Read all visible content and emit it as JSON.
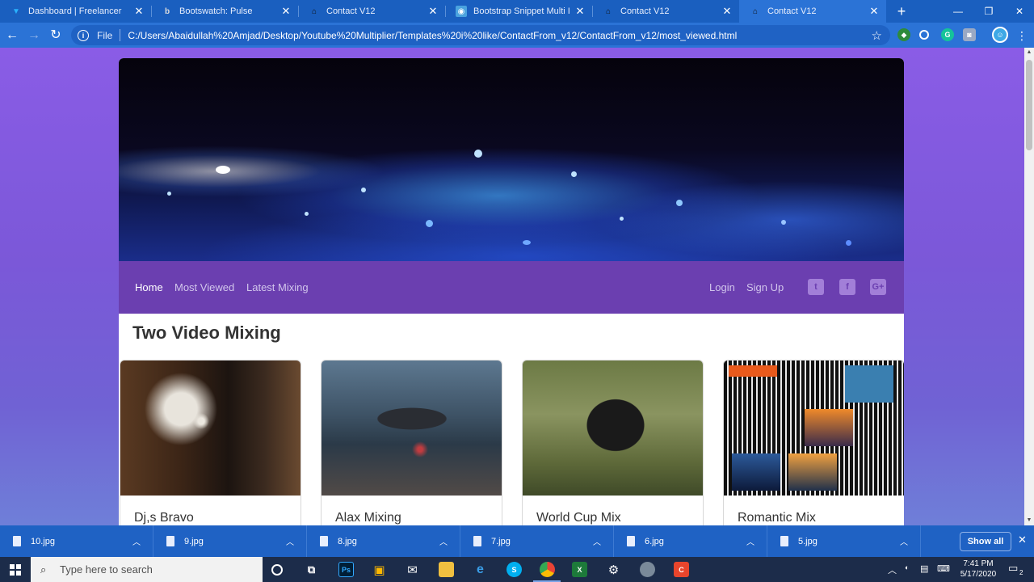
{
  "browser": {
    "tabs": [
      {
        "label": "Dashboard | Freelancer",
        "icon": "freelancer-bird-icon",
        "active": false
      },
      {
        "label": "Bootswatch: Pulse",
        "icon": "bootswatch-icon",
        "active": false
      },
      {
        "label": "Contact V12",
        "icon": "home-icon",
        "active": false
      },
      {
        "label": "Bootstrap Snippet Multi Item",
        "icon": "bootstrap-snippet-icon",
        "active": false
      },
      {
        "label": "Contact V12",
        "icon": "home-icon",
        "active": false
      },
      {
        "label": "Contact V12",
        "icon": "home-icon",
        "active": true
      }
    ],
    "address": {
      "scheme": "File",
      "url": "C:/Users/Abaidullah%20Amjad/Desktop/Youtube%20Multiplier/Templates%20i%20like/ContactFrom_v12/ContactFrom_v12/most_viewed.html"
    }
  },
  "site": {
    "nav": {
      "left": [
        "Home",
        "Most Viewed",
        "Latest Mixing"
      ],
      "right": [
        "Login",
        "Sign Up"
      ],
      "social": [
        "twitter-icon",
        "facebook-icon",
        "google-plus-icon"
      ],
      "social_glyphs": [
        "t",
        "f",
        "G+"
      ]
    },
    "section_title": "Two Video Mixing",
    "cards": [
      {
        "title": "Dj,s Bravo"
      },
      {
        "title": "Alax Mixing"
      },
      {
        "title": "World Cup Mix"
      },
      {
        "title": "Romantic Mix"
      }
    ],
    "colors": {
      "navbar": "#6b3fb0",
      "page_bg": "#7b58d8"
    }
  },
  "downloads": {
    "items": [
      "10.jpg",
      "9.jpg",
      "8.jpg",
      "7.jpg",
      "6.jpg",
      "5.jpg"
    ],
    "show_all": "Show all"
  },
  "taskbar": {
    "search_placeholder": "Type here to search",
    "time": "7:41 PM",
    "date": "5/17/2020",
    "notifications": "2"
  }
}
